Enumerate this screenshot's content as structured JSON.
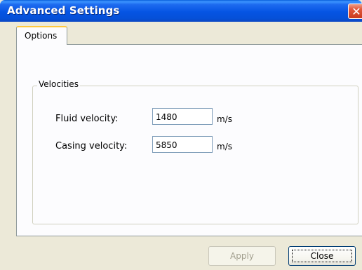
{
  "window": {
    "title": "Advanced Settings"
  },
  "title_buttons": {
    "close_glyph": "✕"
  },
  "tabs": [
    {
      "label": "Options",
      "selected": true
    }
  ],
  "velocities": {
    "group_label": "Velocities",
    "fluid": {
      "label": "Fluid velocity:",
      "value": "1480",
      "unit": "m/s"
    },
    "casing": {
      "label": "Casing velocity:",
      "value": "5850",
      "unit": "m/s"
    }
  },
  "buttons": {
    "apply_label": "Apply",
    "apply_enabled": false,
    "close_label": "Close"
  },
  "colors": {
    "titlebar_blue": "#0554e3",
    "close_red": "#e2583c",
    "dialog_bg": "#ece9d8",
    "tab_accent": "#ffc83c"
  },
  "icons": {
    "close": "close-icon"
  }
}
